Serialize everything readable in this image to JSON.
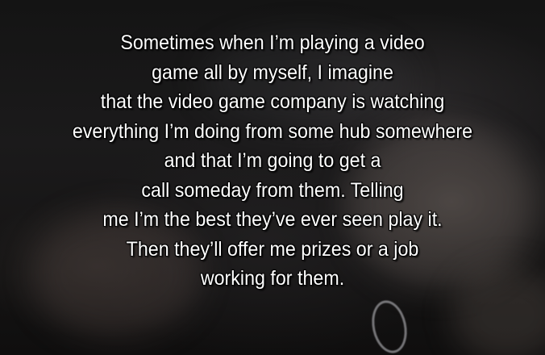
{
  "quote": {
    "lines": [
      "Sometimes when I’m playing a video",
      "game all by myself, I imagine",
      "that the video game company is watching",
      "everything I’m doing from some hub somewhere",
      "and that I’m going to get a",
      "call someday from them. Telling",
      "me I’m the best they’ve ever seen play it.",
      "Then they’ll offer me prizes or a job",
      "working for them."
    ]
  }
}
